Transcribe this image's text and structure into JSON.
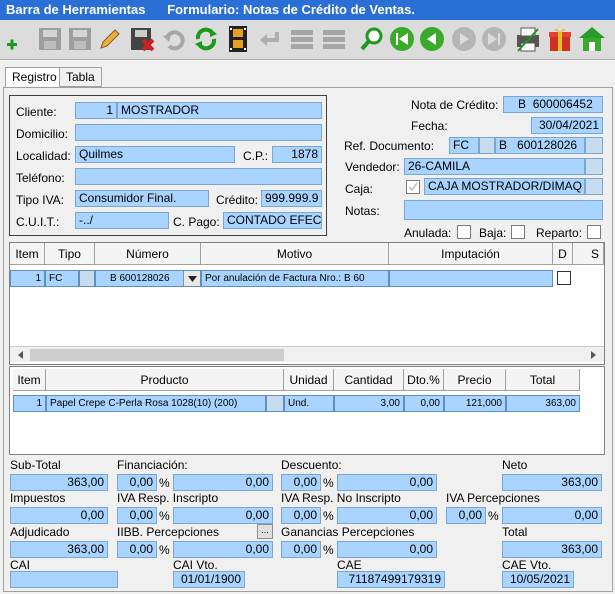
{
  "titlebar": {
    "app": "Barra de Herramientas",
    "form": "Formulario: Notas de Crédito de Ventas."
  },
  "toolbar": {
    "icons": [
      "add-icon",
      "save-icon",
      "save-as-icon",
      "edit-icon",
      "delete-icon",
      "undo-icon",
      "refresh-icon",
      "film-icon",
      "back-arrow-icon",
      "list-icon",
      "list2-icon",
      "search-icon",
      "first-icon",
      "prev-icon",
      "next-icon",
      "last-icon",
      "printer-icon",
      "gift-icon",
      "home-icon"
    ]
  },
  "tabs": [
    "Registro",
    "Tabla"
  ],
  "cliente": {
    "label": "Cliente:",
    "code": "1",
    "name": "MOSTRADOR"
  },
  "domicilio": {
    "label": "Domicilio:",
    "value": ""
  },
  "localidad": {
    "label": "Localidad:",
    "value": "Quilmes",
    "cp_label": "C.P.:",
    "cp": "1878"
  },
  "telefono": {
    "label": "Teléfono:",
    "value": ""
  },
  "tipo_iva": {
    "label": "Tipo IVA:",
    "value": "Consumidor Final.",
    "credito_label": "Crédito:",
    "credito": "999.999.9"
  },
  "cuit": {
    "label": "C.U.I.T.:",
    "value": "-../",
    "cpago_label": "C. Pago:",
    "cpago": "CONTADO EFEC"
  },
  "nota": {
    "label": "Nota de Crédito:",
    "letra": "B",
    "numero": "600006452"
  },
  "fecha": {
    "label": "Fecha:",
    "value": "30/04/2021"
  },
  "refdoc": {
    "label": "Ref. Documento:",
    "tipo": "FC",
    "letra": "B",
    "numero": "600128026"
  },
  "vendedor": {
    "label": "Vendedor:",
    "value": "26-CAMILA"
  },
  "caja": {
    "label": "Caja:",
    "value": "CAJA MOSTRADOR/DIMAQ"
  },
  "notas": {
    "label": "Notas:",
    "value": ""
  },
  "flags": {
    "anulada": "Anulada:",
    "baja": "Baja:",
    "reparto": "Reparto:"
  },
  "grid1": {
    "headers": [
      "Item",
      "Tipo",
      "Número",
      "Motivo",
      "Imputación",
      "D",
      "S"
    ],
    "row": {
      "item": "1",
      "tipo": "FC",
      "numero": "B   600128026",
      "motivo": "Por anulación de Factura Nro.: B   60",
      "imputacion": ""
    }
  },
  "grid2": {
    "headers": [
      "Item",
      "Producto",
      "Unidad",
      "Cantidad",
      "Dto.%",
      "Precio",
      "Total"
    ],
    "row": {
      "item": "1",
      "producto": "Papel Crepe C-Perla Rosa 1028(10) (200)",
      "unidad": "Und.",
      "cantidad": "3,00",
      "dto": "0,00",
      "precio": "121,000",
      "total": "363,00"
    }
  },
  "totals": {
    "subtotal_label": "Sub-Total",
    "subtotal": "363,00",
    "financiacion_label": "Financiación:",
    "fin_pct": "0,00",
    "fin_val": "0,00",
    "descuento_label": "Descuento:",
    "desc_pct": "0,00",
    "desc_val": "0,00",
    "neto_label": "Neto",
    "neto": "363,00",
    "impuestos_label": "Impuestos",
    "impuestos": "0,00",
    "ivari_label": "IVA Resp. Inscripto",
    "ivari_pct": "0,00",
    "ivari_val": "0,00",
    "ivarni_label": "IVA Resp. No Inscripto",
    "ivarni_pct": "0,00",
    "ivarni_val": "0,00",
    "ivaperc_label": "IVA Percepciones",
    "ivaperc_pct": "0,00",
    "ivaperc_val": "0,00",
    "adjudicado_label": "Adjudicado",
    "adjudicado": "363,00",
    "iibb_label": "IIBB. Percepciones",
    "iibb_pct": "0,00",
    "iibb_val": "0,00",
    "ganancias_label": "Ganancias Percepciones",
    "gan_pct": "0,00",
    "gan_val": "0,00",
    "total_label": "Total",
    "total": "363,00",
    "cai_label": "CAI",
    "cai": "",
    "caivto_label": "CAI Vto.",
    "caivto": "01/01/1900",
    "cae_label": "CAE",
    "cae": "71187499179319",
    "caevto_label": "CAE Vto.",
    "caevto": "10/05/2021",
    "pct_sign": "%",
    "dots": "..."
  }
}
